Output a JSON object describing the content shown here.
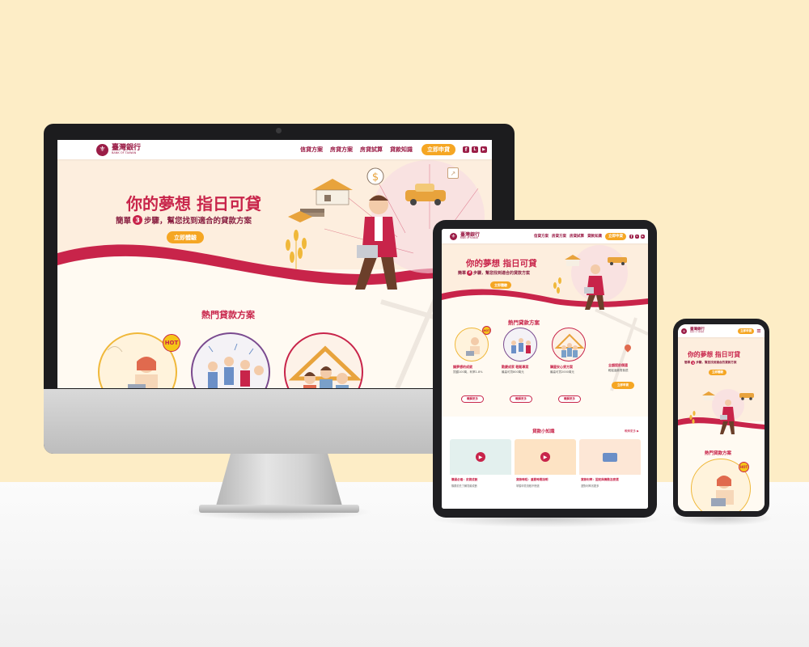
{
  "brand": {
    "logo_cn": "臺灣銀行",
    "logo_en": "BANK OF TAIWAN"
  },
  "nav": {
    "links": [
      "信貸方案",
      "房貸方案",
      "房貸試算",
      "貸款知識"
    ],
    "apply": "立即申貸",
    "social_icons": [
      "facebook-icon",
      "line-icon",
      "youtube-icon"
    ]
  },
  "hero": {
    "title": "你的夢想 指日可貸",
    "sub_before": "簡單",
    "step_num": "3",
    "sub_after": "步驟，幫您找到適合的貸款方案",
    "cta": "立即體驗"
  },
  "hot_loans": {
    "title": "熱門貸款方案",
    "hot": "HOT",
    "more": "瞭解更多",
    "cards": [
      {
        "label": "讓夢想的成就",
        "desc": "貸額100萬，利率1.8%"
      },
      {
        "label": "歡慶成家 輕鬆專案",
        "desc": "最高可貸800萬元"
      },
      {
        "label": "購屋安心貸方案",
        "desc": "最高可貸2000萬元"
      }
    ],
    "extra": {
      "label": "全額提前償還",
      "desc": "輕鬆還款零負擔",
      "btn": "立即申貸"
    }
  },
  "knowledge": {
    "title": "貸款小知識",
    "more": "瞭解更多 ▶",
    "cards": [
      {
        "title": "購屋必看：房貸成數",
        "text": "購屋前先了解貸款成數"
      },
      {
        "title": "貸款時程：重要時間說明",
        "text": "掌握申貸流程不慌張"
      },
      {
        "title": "貸款利率：固定與機動怎麼選",
        "text": "選對利率省更多"
      }
    ]
  },
  "colors": {
    "primary": "#c8244a",
    "accent": "#f5a623",
    "cream": "#fff8ee",
    "wall": "#fdedc6"
  }
}
